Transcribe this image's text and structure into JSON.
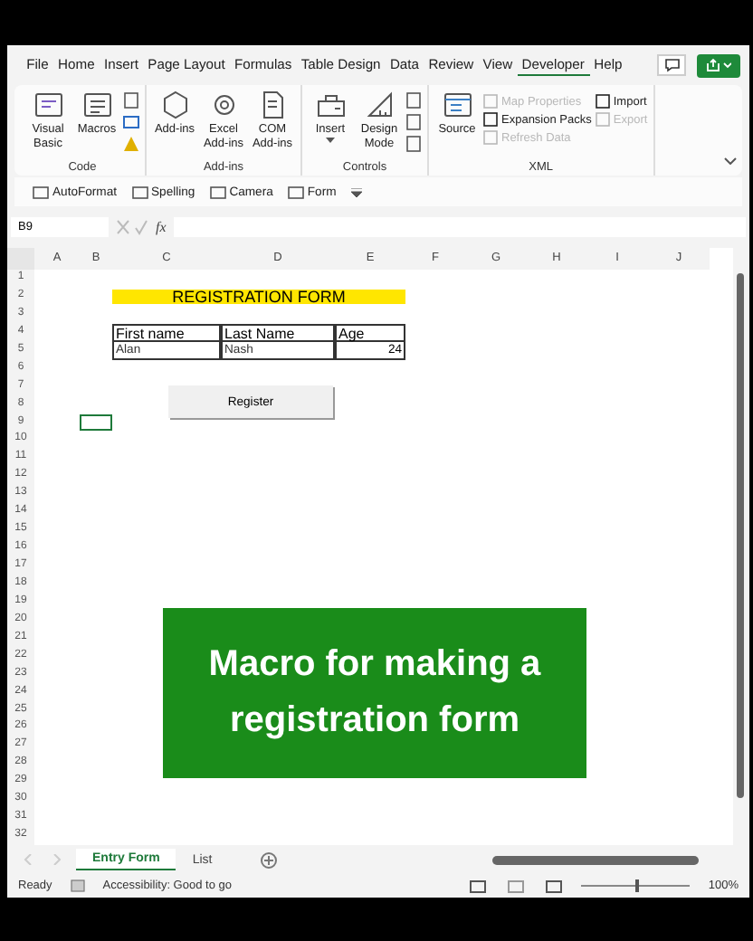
{
  "ribbon_tabs": [
    {
      "label": "File",
      "selected": false
    },
    {
      "label": "Home",
      "selected": false
    },
    {
      "label": "Insert",
      "selected": false
    },
    {
      "label": "Page Layout",
      "selected": false
    },
    {
      "label": "Formulas",
      "selected": false
    },
    {
      "label": "Table Design",
      "selected": false
    },
    {
      "label": "Data",
      "selected": false
    },
    {
      "label": "Review",
      "selected": false
    },
    {
      "label": "View",
      "selected": false
    },
    {
      "label": "Developer",
      "selected": true
    },
    {
      "label": "Help",
      "selected": false
    }
  ],
  "ribbon_groups": [
    {
      "label": "Code",
      "items": [
        {
          "kind": "big",
          "label": "Visual Basic"
        },
        {
          "kind": "big",
          "label": "Macros"
        },
        {
          "kind": "smallstack"
        }
      ]
    },
    {
      "label": "Add-ins",
      "items": [
        {
          "kind": "big",
          "label": "Add-ins"
        },
        {
          "kind": "big",
          "label": "Excel Add-ins"
        },
        {
          "kind": "big",
          "label": "COM Add-ins"
        }
      ]
    },
    {
      "label": "Controls",
      "items": [
        {
          "kind": "menu",
          "label": "Insert"
        },
        {
          "kind": "big",
          "label": "Design Mode"
        },
        {
          "kind": "smallstack"
        }
      ]
    },
    {
      "label": "XML",
      "items": [
        {
          "kind": "big",
          "label": "Source"
        },
        {
          "kind": "list",
          "entries": [
            {
              "label": "Map Properties",
              "disabled": true
            },
            {
              "label": "Expansion Packs",
              "disabled": false
            },
            {
              "label": "Refresh Data",
              "disabled": true
            }
          ]
        },
        {
          "kind": "list",
          "entries": [
            {
              "label": "Import",
              "disabled": false
            },
            {
              "label": "Export",
              "disabled": true
            }
          ]
        }
      ]
    }
  ],
  "quick_access": [
    "AutoFormat",
    "Spelling",
    "Camera",
    "Form"
  ],
  "formula_bar": {
    "name_box": "B9",
    "function_label": "fx"
  },
  "columns": [
    "A",
    "B",
    "C",
    "D",
    "E",
    "F",
    "G",
    "H",
    "I",
    "J"
  ],
  "rows": [
    "1",
    "2",
    "3",
    "4",
    "5",
    "6",
    "7",
    "8",
    "9",
    "10",
    "11",
    "12",
    "13",
    "14",
    "15",
    "16",
    "17",
    "18",
    "19",
    "20",
    "21",
    "22",
    "23",
    "24",
    "25",
    "26",
    "27",
    "28",
    "29",
    "30",
    "31",
    "32"
  ],
  "form": {
    "title": "REGISTRATION FORM",
    "headers": [
      "First name",
      "Last Name",
      "Age"
    ],
    "values": [
      {
        "kind": "text",
        "text": "Alan"
      },
      {
        "kind": "text",
        "text": "Nash"
      },
      {
        "kind": "number",
        "text": "24"
      }
    ]
  },
  "form_button": {
    "label": "Register"
  },
  "overlay_caption": "Macro for making a registration form",
  "sheet_tabs": [
    {
      "label": "Entry Form",
      "selected": true
    },
    {
      "label": "List",
      "selected": false
    }
  ],
  "status_bar": {
    "state": "Ready",
    "accessibility": "Accessibility: Good to go",
    "zoom": "100%",
    "zoom_slider": {
      "level": 0.5
    }
  }
}
